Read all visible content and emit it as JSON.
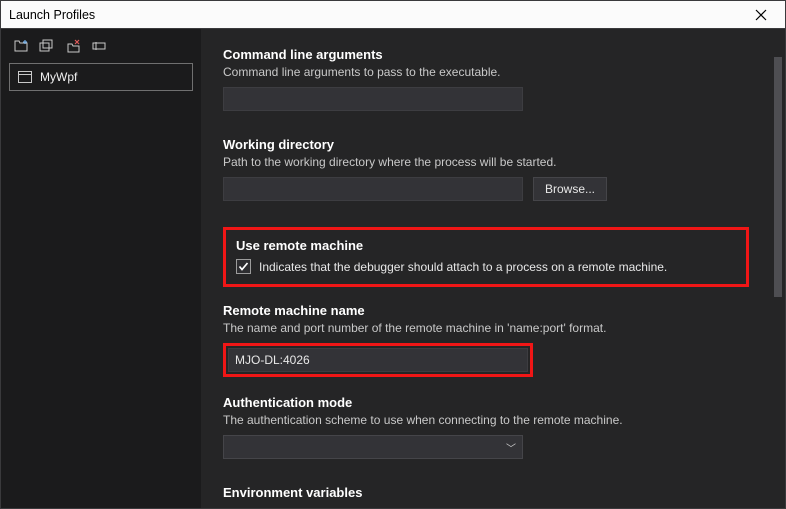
{
  "window": {
    "title": "Launch Profiles"
  },
  "sidebar": {
    "profile": {
      "name": "MyWpf"
    }
  },
  "sections": {
    "cmdargs": {
      "title": "Command line arguments",
      "desc": "Command line arguments to pass to the executable.",
      "value": ""
    },
    "workdir": {
      "title": "Working directory",
      "desc": "Path to the working directory where the process will be started.",
      "value": "",
      "browse_label": "Browse..."
    },
    "remote": {
      "title": "Use remote machine",
      "desc": "Indicates that the debugger should attach to a process on a remote machine.",
      "checked": true
    },
    "remotename": {
      "title": "Remote machine name",
      "desc": "The name and port number of the remote machine in 'name:port' format.",
      "value": "MJO-DL:4026"
    },
    "auth": {
      "title": "Authentication mode",
      "desc": "The authentication scheme to use when connecting to the remote machine.",
      "value": ""
    },
    "envvars": {
      "title": "Environment variables"
    }
  }
}
